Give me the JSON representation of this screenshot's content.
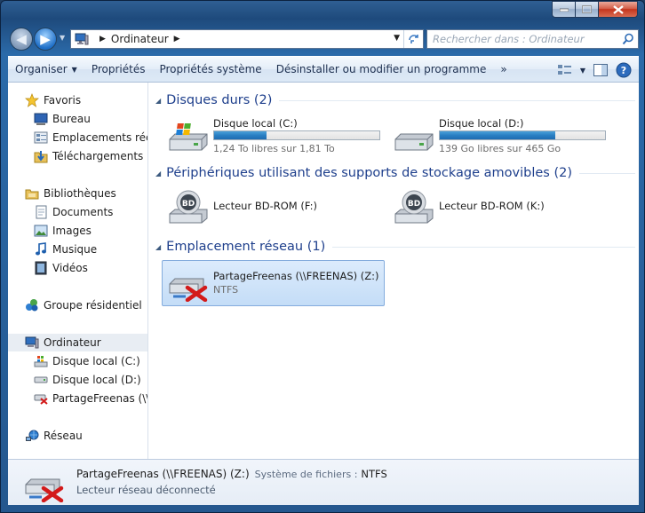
{
  "window": {
    "controls": [
      "minimize",
      "maximize",
      "close"
    ]
  },
  "address_bar": {
    "crumbs": [
      "Ordinateur"
    ]
  },
  "search": {
    "placeholder": "Rechercher dans : Ordinateur"
  },
  "toolbar": {
    "organize": "Organiser",
    "properties": "Propriétés",
    "system_properties": "Propriétés système",
    "uninstall": "Désinstaller ou modifier un programme",
    "more": "»"
  },
  "nav": {
    "favorites": "Favoris",
    "desktop": "Bureau",
    "recent_places": "Emplacements récents",
    "downloads": "Téléchargements",
    "libraries": "Bibliothèques",
    "documents": "Documents",
    "images": "Images",
    "music": "Musique",
    "videos": "Vidéos",
    "homegroup": "Groupe résidentiel",
    "computer": "Ordinateur",
    "disk_c": "Disque local (C:)",
    "disk_d": "Disque local (D:)",
    "share": "PartageFreenas (\\\\FREENAS) (Z:)",
    "network": "Réseau"
  },
  "groups": {
    "hard_disks": "Disques durs (2)",
    "removable": "Périphériques utilisant des supports de stockage amovibles (2)",
    "network": "Emplacement réseau (1)"
  },
  "drives": {
    "c": {
      "name": "Disque local (C:)",
      "free": "1,24 To libres sur 1,81 To",
      "used_fraction": 0.315
    },
    "d": {
      "name": "Disque local (D:)",
      "free": "139 Go libres sur 465 Go",
      "used_fraction": 0.7
    },
    "f": {
      "name": "Lecteur BD-ROM (F:)"
    },
    "k": {
      "name": "Lecteur BD-ROM (K:)"
    },
    "z": {
      "name": "PartageFreenas (\\\\FREENAS) (Z:)",
      "fs": "NTFS"
    }
  },
  "details": {
    "name": "PartageFreenas (\\\\FREENAS) (Z:)",
    "fs_label": "Système de fichiers :",
    "fs_value": "NTFS",
    "status": "Lecteur réseau déconnecté"
  },
  "colors": {
    "accent": "#1e3f8c",
    "progress": "#2a7fc3",
    "disconnect": "#d31a1a"
  }
}
